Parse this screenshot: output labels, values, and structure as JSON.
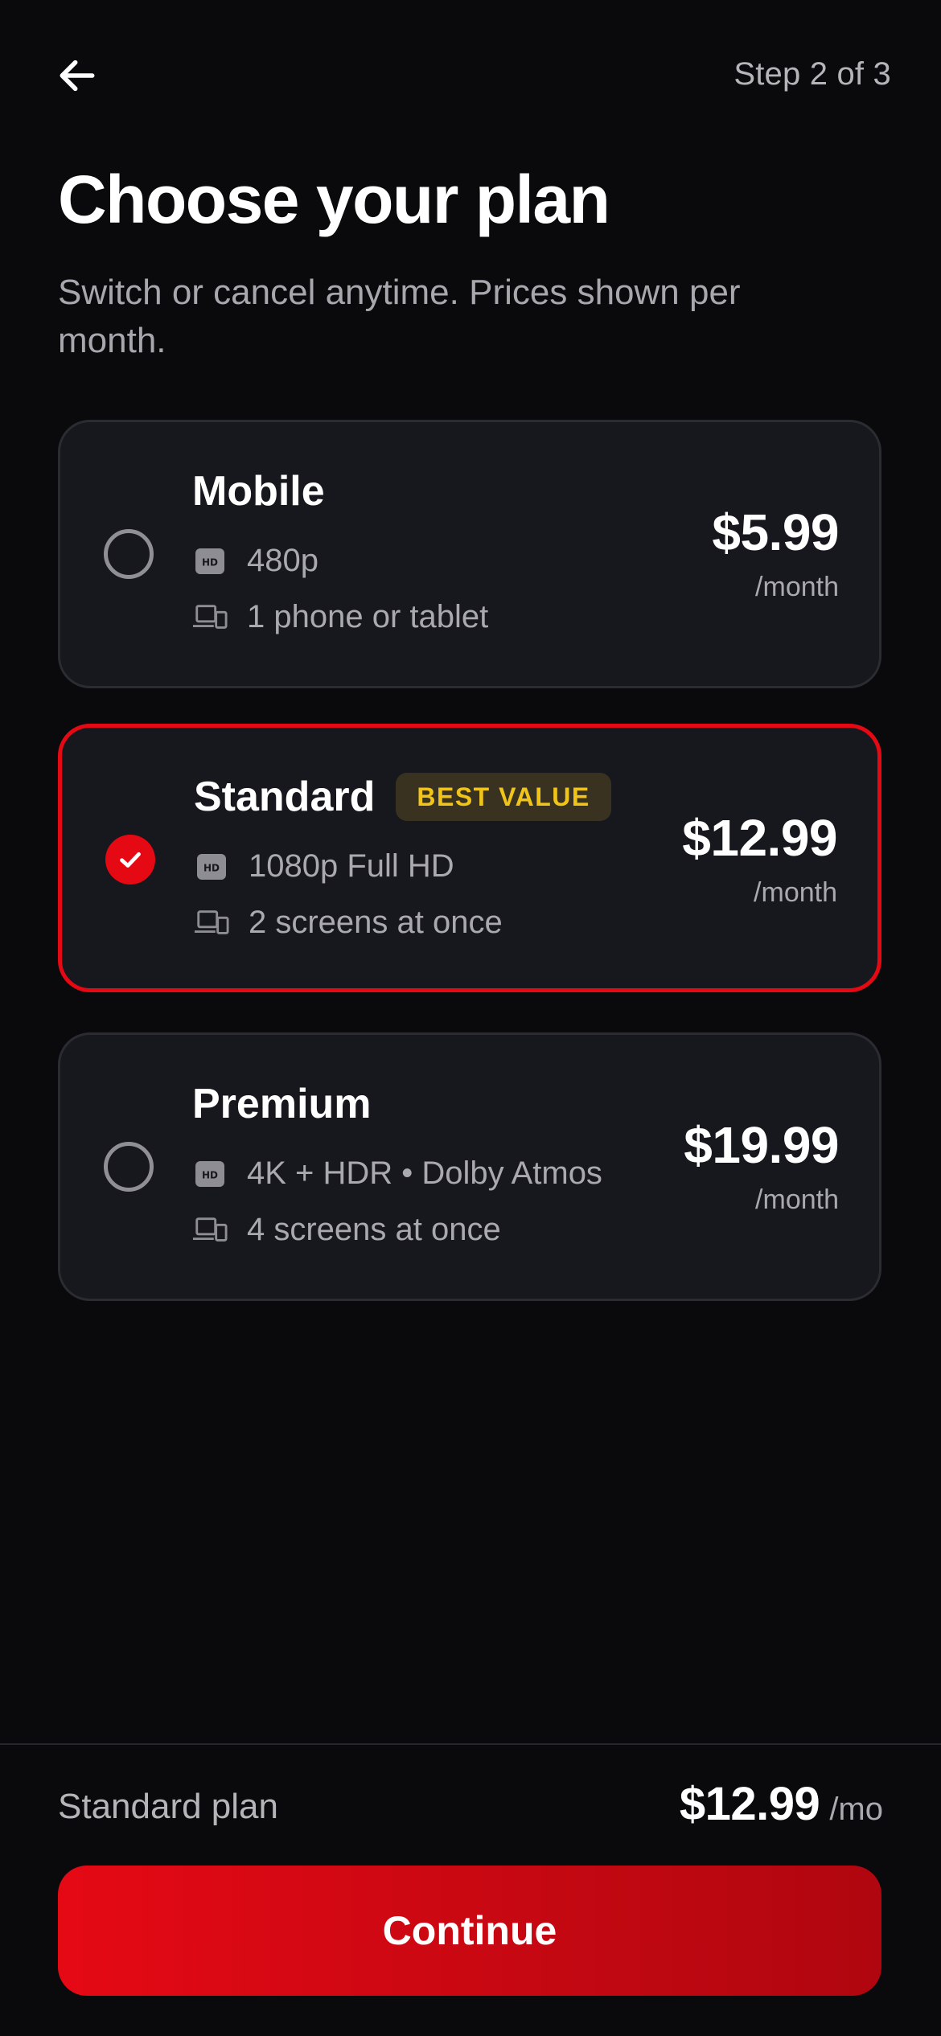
{
  "header": {
    "step": "Step 2 of 3",
    "title": "Choose your plan",
    "subtitle": "Switch or cancel anytime. Prices shown per month."
  },
  "plans": [
    {
      "name": "Mobile",
      "badge": "",
      "quality": "480p",
      "screens": "1 phone or tablet",
      "price": "$5.99",
      "period": "/month",
      "selected": false
    },
    {
      "name": "Standard",
      "badge": "BEST VALUE",
      "quality": "1080p Full HD",
      "screens": "2 screens at once",
      "price": "$12.99",
      "period": "/month",
      "selected": true
    },
    {
      "name": "Premium",
      "badge": "",
      "quality": "4K + HDR • Dolby Atmos",
      "screens": "4 screens at once",
      "price": "$19.99",
      "period": "/month",
      "selected": false
    }
  ],
  "summary": {
    "label": "Standard plan",
    "price": "$12.99",
    "unit": "/mo"
  },
  "cta": {
    "label": "Continue"
  },
  "icons": {
    "back": "arrow-left-icon",
    "quality": "hd-icon",
    "screens": "devices-icon",
    "check": "check-icon"
  },
  "colors": {
    "background": "#0a0a0d",
    "card": "#17181d",
    "accent": "#e50914",
    "badge_text": "#f0c419",
    "badge_bg": "#3a3220",
    "muted_text": "#a9a9af"
  }
}
